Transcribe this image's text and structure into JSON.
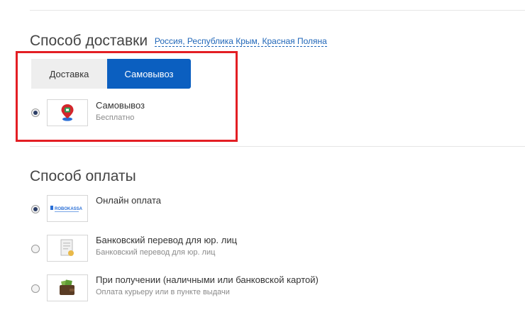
{
  "delivery": {
    "title": "Способ доставки",
    "location": "Россия, Республика Крым, Красная Поляна",
    "tabs": [
      {
        "label": "Доставка",
        "active": false
      },
      {
        "label": "Самовывоз",
        "active": true
      }
    ],
    "option": {
      "title": "Самовывоз",
      "subtitle": "Бесплатно",
      "selected": true,
      "icon": "map-pin-icon"
    }
  },
  "payment": {
    "title": "Способ оплаты",
    "options": [
      {
        "title": "Онлайн оплата",
        "subtitle": "",
        "selected": true,
        "icon": "robokassa-logo",
        "logo_text": "ROBOKASSA"
      },
      {
        "title": "Банковский перевод для юр. лиц",
        "subtitle": "Банковский перевод для юр. лиц",
        "selected": false,
        "icon": "invoice-icon"
      },
      {
        "title": "При получении (наличными или банковской картой)",
        "subtitle": "Оплата курьеру или в пункте выдачи",
        "selected": false,
        "icon": "wallet-icon"
      }
    ]
  },
  "colors": {
    "accent": "#0b5fc0",
    "highlight": "#e31e24",
    "link": "#1f66b8"
  }
}
